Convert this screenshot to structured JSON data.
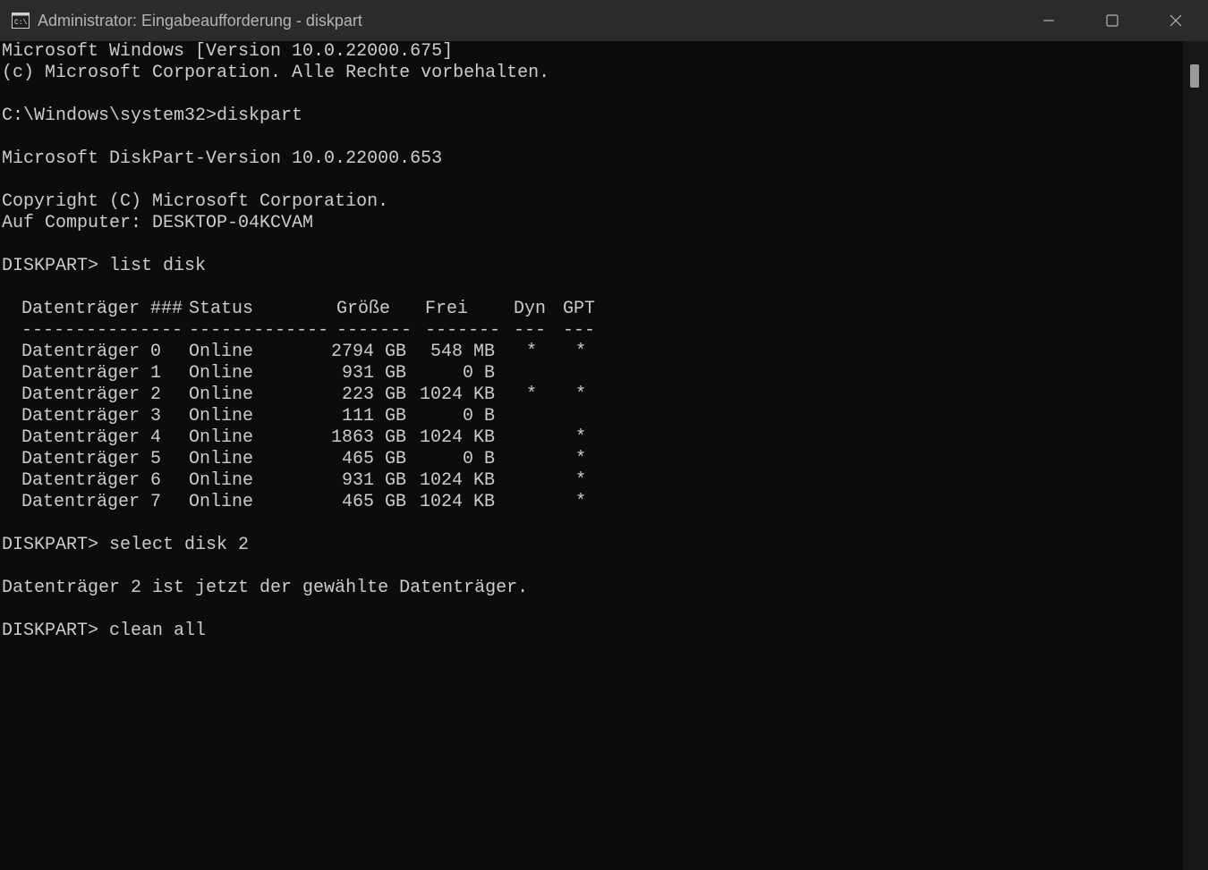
{
  "window": {
    "title": "Administrator: Eingabeaufforderung - diskpart",
    "controls": {
      "minimize_icon": "minimize-icon",
      "maximize_icon": "maximize-icon",
      "close_icon": "close-icon"
    }
  },
  "console": {
    "intro": [
      "Microsoft Windows [Version 10.0.22000.675]",
      "(c) Microsoft Corporation. Alle Rechte vorbehalten.",
      "",
      "C:\\Windows\\system32>diskpart",
      "",
      "Microsoft DiskPart-Version 10.0.22000.653",
      "",
      "Copyright (C) Microsoft Corporation.",
      "Auf Computer: DESKTOP-04KCVAM",
      "",
      "DISKPART> list disk",
      ""
    ],
    "disk_table": {
      "headers": {
        "disk": "Datenträger ###",
        "status": "Status",
        "size": "Größe",
        "free": "Frei",
        "dyn": "Dyn",
        "gpt": "GPT"
      },
      "separators": {
        "disk": "---------------",
        "status": "-------------",
        "size": "-------",
        "free": "-------",
        "dyn": "---",
        "gpt": "---"
      },
      "rows": [
        {
          "disk": "Datenträger 0",
          "status": "Online",
          "size": "2794 GB",
          "free": "548 MB",
          "dyn": "*",
          "gpt": "*"
        },
        {
          "disk": "Datenträger 1",
          "status": "Online",
          "size": "931 GB",
          "free": "0 B",
          "dyn": "",
          "gpt": ""
        },
        {
          "disk": "Datenträger 2",
          "status": "Online",
          "size": "223 GB",
          "free": "1024 KB",
          "dyn": "*",
          "gpt": "*"
        },
        {
          "disk": "Datenträger 3",
          "status": "Online",
          "size": "111 GB",
          "free": "0 B",
          "dyn": "",
          "gpt": ""
        },
        {
          "disk": "Datenträger 4",
          "status": "Online",
          "size": "1863 GB",
          "free": "1024 KB",
          "dyn": "",
          "gpt": "*"
        },
        {
          "disk": "Datenträger 5",
          "status": "Online",
          "size": "465 GB",
          "free": "0 B",
          "dyn": "",
          "gpt": "*"
        },
        {
          "disk": "Datenträger 6",
          "status": "Online",
          "size": "931 GB",
          "free": "1024 KB",
          "dyn": "",
          "gpt": "*"
        },
        {
          "disk": "Datenträger 7",
          "status": "Online",
          "size": "465 GB",
          "free": "1024 KB",
          "dyn": "",
          "gpt": "*"
        }
      ]
    },
    "outro": [
      "",
      "DISKPART> select disk 2",
      "",
      "Datenträger 2 ist jetzt der gewählte Datenträger.",
      "",
      "DISKPART> clean all"
    ]
  },
  "colors": {
    "background": "#0c0c0c",
    "titlebar": "#2b2b2b",
    "text": "#cccccc"
  }
}
